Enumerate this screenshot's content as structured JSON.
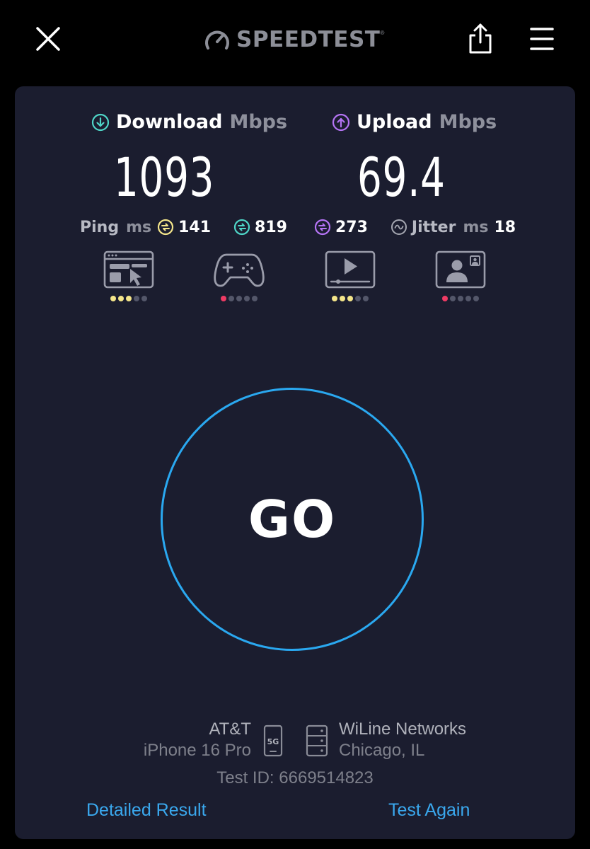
{
  "header": {
    "brand": "SPEEDTEST",
    "brand_mark": "®",
    "icons": {
      "close": "close-icon",
      "logo": "speedometer-icon",
      "share": "share-icon",
      "menu": "hamburger-menu-icon"
    }
  },
  "download": {
    "label": "Download",
    "unit": "Mbps",
    "value": "1093",
    "icon": "download-arrow-icon"
  },
  "upload": {
    "label": "Upload",
    "unit": "Mbps",
    "value": "69.4",
    "icon": "upload-arrow-icon"
  },
  "ping": {
    "label": "Ping",
    "unit": "ms",
    "idle": "141",
    "download": "819",
    "upload": "273",
    "jitter_label": "Jitter",
    "jitter_unit": "ms",
    "jitter": "18"
  },
  "quality": [
    {
      "name": "browsing",
      "icon": "browsing-icon",
      "rating": 3,
      "color": "yellow"
    },
    {
      "name": "gaming",
      "icon": "gamepad-icon",
      "rating": 1,
      "color": "red"
    },
    {
      "name": "streaming",
      "icon": "video-play-icon",
      "rating": 3,
      "color": "yellow"
    },
    {
      "name": "video-chat",
      "icon": "video-call-icon",
      "rating": 1,
      "color": "red"
    }
  ],
  "go_label": "GO",
  "provider": {
    "name": "AT&T",
    "device": "iPhone 16 Pro",
    "network_badge": "5G"
  },
  "server": {
    "name": "WiLine Networks",
    "location": "Chicago, IL"
  },
  "test_id": "Test ID: 6669514823",
  "links": {
    "detailed": "Detailed Result",
    "again": "Test Again"
  },
  "colors": {
    "background": "#000000",
    "card": "#1b1d2f",
    "download_accent": "#4fd6c8",
    "upload_accent": "#b574f5",
    "ping_idle": "#f4e58a",
    "go_ring": "#2aa8f0",
    "link": "#3aa8ee",
    "rating_good": "#f4e58a",
    "rating_bad": "#ef3b64"
  }
}
